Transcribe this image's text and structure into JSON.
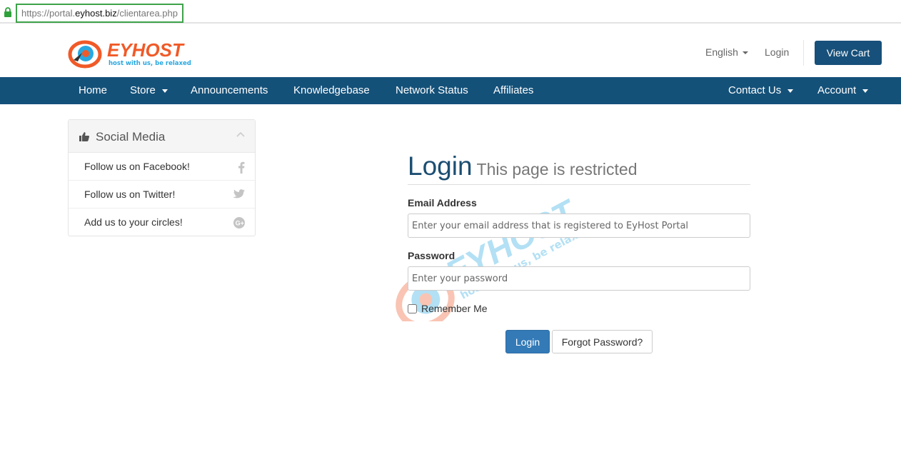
{
  "browser": {
    "url_prefix": "https://portal.",
    "url_domain": "eyhost.biz",
    "url_path": "/clientarea.php"
  },
  "header": {
    "logo_text": "EYHOST",
    "logo_tagline": "host with us, be relaxed",
    "language": "English",
    "login_link": "Login",
    "view_cart": "View Cart"
  },
  "nav": {
    "items": [
      {
        "label": "Home"
      },
      {
        "label": "Store"
      },
      {
        "label": "Announcements"
      },
      {
        "label": "Knowledgebase"
      },
      {
        "label": "Network Status"
      },
      {
        "label": "Affiliates"
      },
      {
        "label": "Contact Us"
      },
      {
        "label": "Account"
      }
    ]
  },
  "sidebar": {
    "title": "Social Media",
    "items": [
      {
        "label": "Follow us on Facebook!",
        "icon": "facebook-icon"
      },
      {
        "label": "Follow us on Twitter!",
        "icon": "twitter-icon"
      },
      {
        "label": "Add us to your circles!",
        "icon": "google-plus-icon"
      }
    ]
  },
  "login": {
    "title": "Login",
    "subtitle": "This page is restricted",
    "email_label": "Email Address",
    "email_placeholder": "Enter your email address that is registered to EyHost Portal",
    "password_label": "Password",
    "password_placeholder": "Enter your password",
    "remember_label": "Remember Me",
    "login_button": "Login",
    "forgot_button": "Forgot Password?"
  },
  "colors": {
    "brand_navy": "#145179",
    "button_blue": "#337ab7",
    "logo_orange": "#f05a28",
    "logo_blue": "#29a8e0",
    "url_highlight": "#3ea34a"
  }
}
